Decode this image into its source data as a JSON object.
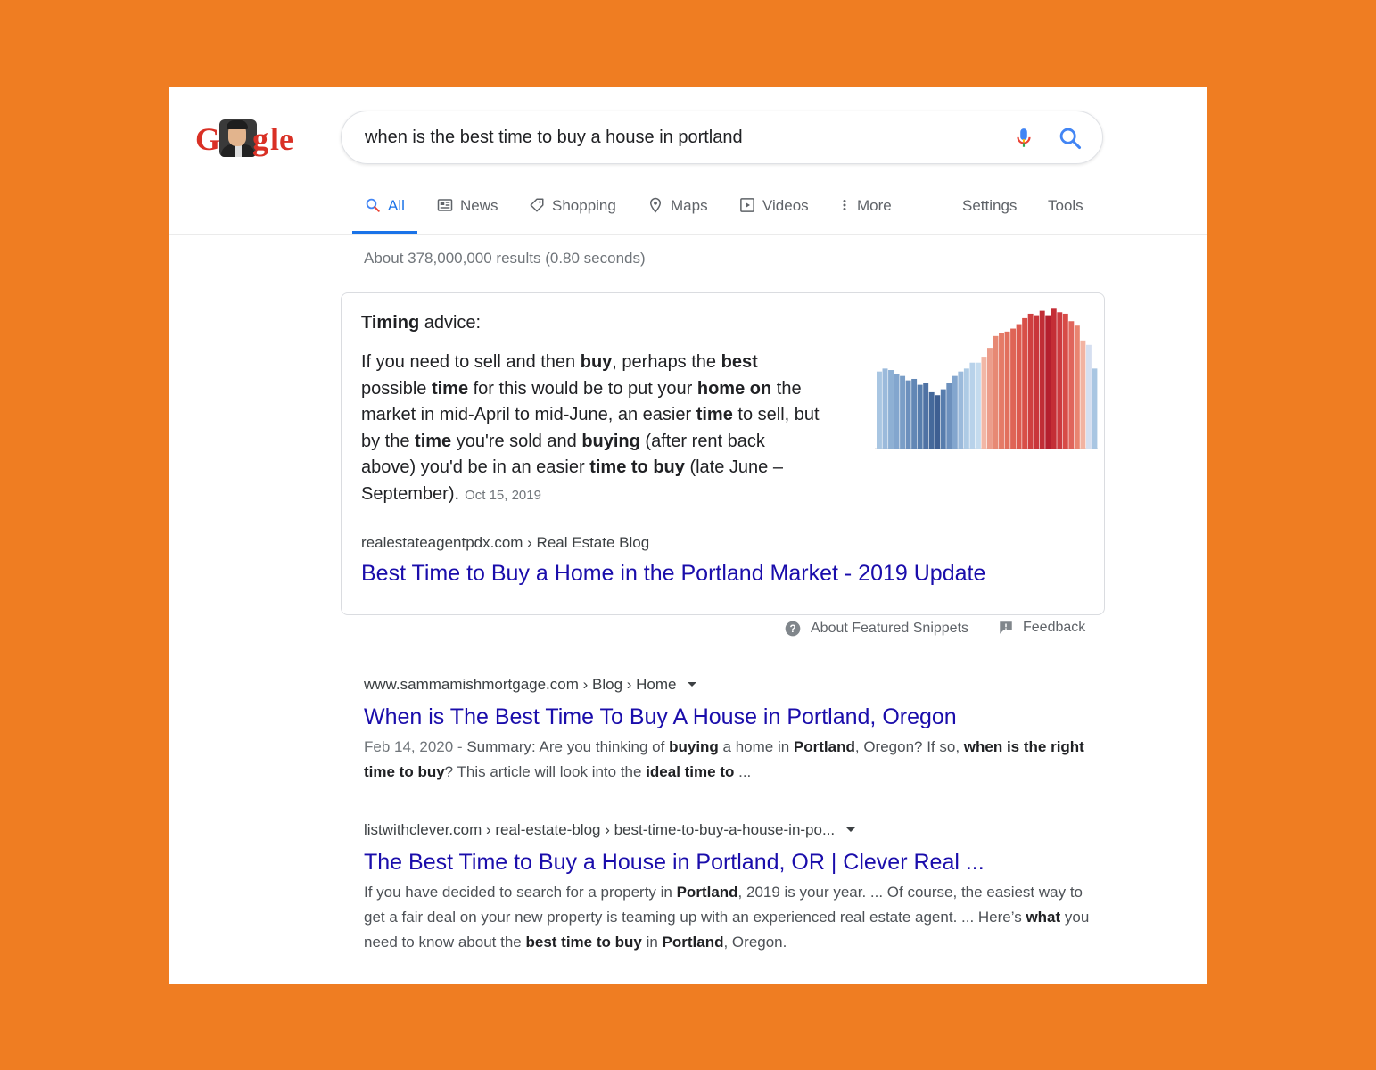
{
  "logo": {
    "letters": [
      "G",
      "g",
      "l",
      "e"
    ],
    "colors": [
      "#d93025",
      "#d93025",
      "#d93025",
      "#d93025"
    ]
  },
  "search": {
    "query": "when is the best time to buy a house in portland"
  },
  "tabs": [
    {
      "label": "All",
      "icon": "search-icon",
      "active": true
    },
    {
      "label": "News",
      "icon": "newspaper-icon"
    },
    {
      "label": "Shopping",
      "icon": "tag-icon"
    },
    {
      "label": "Maps",
      "icon": "map-pin-icon"
    },
    {
      "label": "Videos",
      "icon": "play-icon"
    },
    {
      "label": "More",
      "icon": "more-vertical-icon"
    }
  ],
  "tools": {
    "settings": "Settings",
    "tools": "Tools"
  },
  "stats": "About 378,000,000 results (0.80 seconds)",
  "featured": {
    "heading_bold": "Timing",
    "heading_rest": " advice:",
    "body": [
      {
        "t": "If you need to sell and then "
      },
      {
        "t": "buy",
        "b": true
      },
      {
        "t": ", perhaps the "
      },
      {
        "t": "best",
        "b": true
      },
      {
        "t": " possible "
      },
      {
        "t": "time",
        "b": true
      },
      {
        "t": " for this would be to put your "
      },
      {
        "t": "home on",
        "b": true
      },
      {
        "t": " the market in mid-April to mid-June, an easier "
      },
      {
        "t": "time",
        "b": true
      },
      {
        "t": " to sell, but by the "
      },
      {
        "t": "time",
        "b": true
      },
      {
        "t": " you're sold and "
      },
      {
        "t": "buying",
        "b": true
      },
      {
        "t": " (after rent back above) you'd be in an easier "
      },
      {
        "t": "time to buy",
        "b": true
      },
      {
        "t": " (late June – September)."
      }
    ],
    "date": "Oct 15, 2019",
    "cite": "realestateagentpdx.com › Real Estate Blog",
    "title": "Best Time to Buy a Home in the Portland Market - 2019 Update"
  },
  "chart_data": {
    "type": "bar",
    "values": [
      52,
      54,
      53,
      50,
      49,
      46,
      47,
      43,
      44,
      38,
      36,
      40,
      44,
      49,
      52,
      54,
      58,
      58,
      62,
      68,
      76,
      78,
      79,
      81,
      84,
      88,
      91,
      90,
      93,
      90,
      95,
      92,
      91,
      86,
      83,
      73,
      70,
      54
    ],
    "colors": [
      "#a9c6e2",
      "#9bbadb",
      "#8eb0d4",
      "#83a6ce",
      "#7a9ec7",
      "#6c90bd",
      "#6287b5",
      "#577dad",
      "#4f72a4",
      "#45699b",
      "#3e5f92",
      "#577dad",
      "#6c90bd",
      "#83a6ce",
      "#9bbadb",
      "#aecbe5",
      "#b8d2ea",
      "#c4dbee",
      "#f2b7a6",
      "#ec9d8b",
      "#e78974",
      "#e57b67",
      "#e2705d",
      "#df6456",
      "#dc5a4f",
      "#d84f48",
      "#cf3f40",
      "#c9353a",
      "#c12d36",
      "#b51f2e",
      "#c42e36",
      "#cc3a3f",
      "#d74b47",
      "#e0655b",
      "#e98470",
      "#f2b3a1",
      "#d5dff0",
      "#a9c6e2"
    ]
  },
  "snippet_footer": {
    "about": "About Featured Snippets",
    "feedback": "Feedback"
  },
  "results": [
    {
      "cite": "www.sammamishmortgage.com › Blog › Home",
      "title": "When is The Best Time To Buy A House in Portland, Oregon",
      "snippet": [
        {
          "t": "Feb 14, 2020 - ",
          "d": true
        },
        {
          "t": "Summary: Are you thinking of "
        },
        {
          "t": "buying",
          "b": true
        },
        {
          "t": " a home in "
        },
        {
          "t": "Portland",
          "b": true
        },
        {
          "t": ", Oregon? If so, "
        },
        {
          "t": "when is the right time to buy",
          "b": true
        },
        {
          "t": "? This article will look into the "
        },
        {
          "t": "ideal time to",
          "b": true
        },
        {
          "t": " ..."
        }
      ]
    },
    {
      "cite": "listwithclever.com › real-estate-blog › best-time-to-buy-a-house-in-po...",
      "title": "The Best Time to Buy a House in Portland, OR | Clever Real ...",
      "snippet": [
        {
          "t": "If you have decided to search for a property in "
        },
        {
          "t": "Portland",
          "b": true
        },
        {
          "t": ", 2019 is your year. ... Of course, the easiest way to get a fair deal on your new property is teaming up with an experienced real estate agent. ... Here’s "
        },
        {
          "t": "what",
          "b": true
        },
        {
          "t": " you need to know about the "
        },
        {
          "t": "best time to buy",
          "b": true
        },
        {
          "t": " in "
        },
        {
          "t": "Portland",
          "b": true
        },
        {
          "t": ", Oregon."
        }
      ]
    }
  ]
}
